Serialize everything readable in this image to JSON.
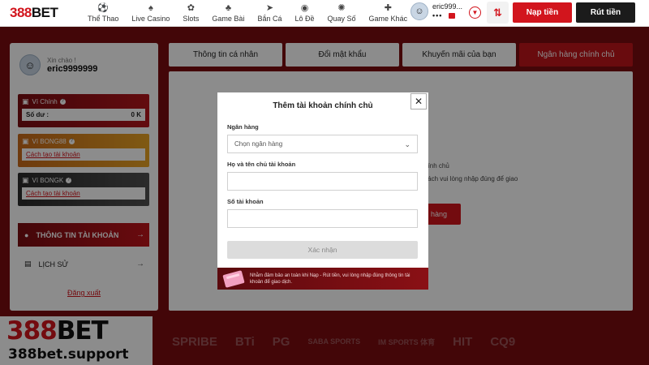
{
  "brand": {
    "red": "388",
    "black": "BET"
  },
  "nav": [
    {
      "label": "Thể Thao",
      "icon": "soccer-ball-icon",
      "glyph": "⚽"
    },
    {
      "label": "Live Casino",
      "icon": "dealer-icon",
      "glyph": "♠"
    },
    {
      "label": "Slots",
      "icon": "slot-icon",
      "glyph": "✿"
    },
    {
      "label": "Game Bài",
      "icon": "cards-icon",
      "glyph": "♣"
    },
    {
      "label": "Bắn Cá",
      "icon": "fish-icon",
      "glyph": "➤"
    },
    {
      "label": "Lô Đề",
      "icon": "lottery-icon",
      "glyph": "◉"
    },
    {
      "label": "Quay Số",
      "icon": "lucky-wheel-icon",
      "glyph": "✺"
    },
    {
      "label": "Game Khác",
      "icon": "gamepad-icon",
      "glyph": "✚"
    }
  ],
  "user": {
    "short_name": "eric999...",
    "balance_mask": "•••",
    "avatar_glyph": "☺"
  },
  "header_buttons": {
    "deposit": "Nạp tiền",
    "withdraw": "Rút tiền",
    "swap_glyph": "⇅"
  },
  "sidebar": {
    "greeting": "Xin chào !",
    "username": "eric9999999",
    "wallets": [
      {
        "name": "Ví Chính",
        "label": "Số dư :",
        "value": "0 K"
      },
      {
        "name": "Ví BONG88",
        "link": "Cách tạo tài khoản"
      },
      {
        "name": "Ví BONGK",
        "link": "Cách tạo tài khoản"
      }
    ],
    "menu_account": "THÔNG TIN TÀI KHOẢN",
    "menu_history": "LỊCH SỬ",
    "logout": "Đăng xuất"
  },
  "tabs": [
    {
      "label": "Thông tin cá nhân",
      "active": false
    },
    {
      "label": "Đổi mật khẩu",
      "active": false
    },
    {
      "label": "Khuyến mãi của bạn",
      "active": false
    },
    {
      "label": "Ngân hàng chính chủ",
      "active": true
    }
  ],
  "background_panel": {
    "title": "ng chính chủ",
    "msg": "uý khách vui lòng nhập đúng để giao dịch.",
    "button": "hàng"
  },
  "modal": {
    "title": "Thêm tài khoản chính chủ",
    "close_glyph": "✕",
    "bank_label": "Ngân hàng",
    "bank_select": "Chọn ngân hàng",
    "name_label": "Họ và tên chủ tài khoản",
    "name_value": "",
    "account_label": "Số tài khoản",
    "account_value": "",
    "submit": "Xác nhận",
    "notice": "Nhằm đảm bảo an toàn khi Nạp - Rút tiền, vui lòng nhập đúng thông tin tài khoản để giao dịch."
  },
  "promo": {
    "logo_red": "388",
    "logo_black": "BET",
    "url": "388bet.support"
  },
  "partners": [
    "SPRIBE",
    "BTi",
    "PG",
    "SABA SPORTS",
    "IM SPORTS 体育",
    "HIT",
    "CQ9"
  ],
  "colors": {
    "accent": "#d2151d",
    "dark": "#1b1b1b",
    "backdrop": "#7a0c10"
  }
}
